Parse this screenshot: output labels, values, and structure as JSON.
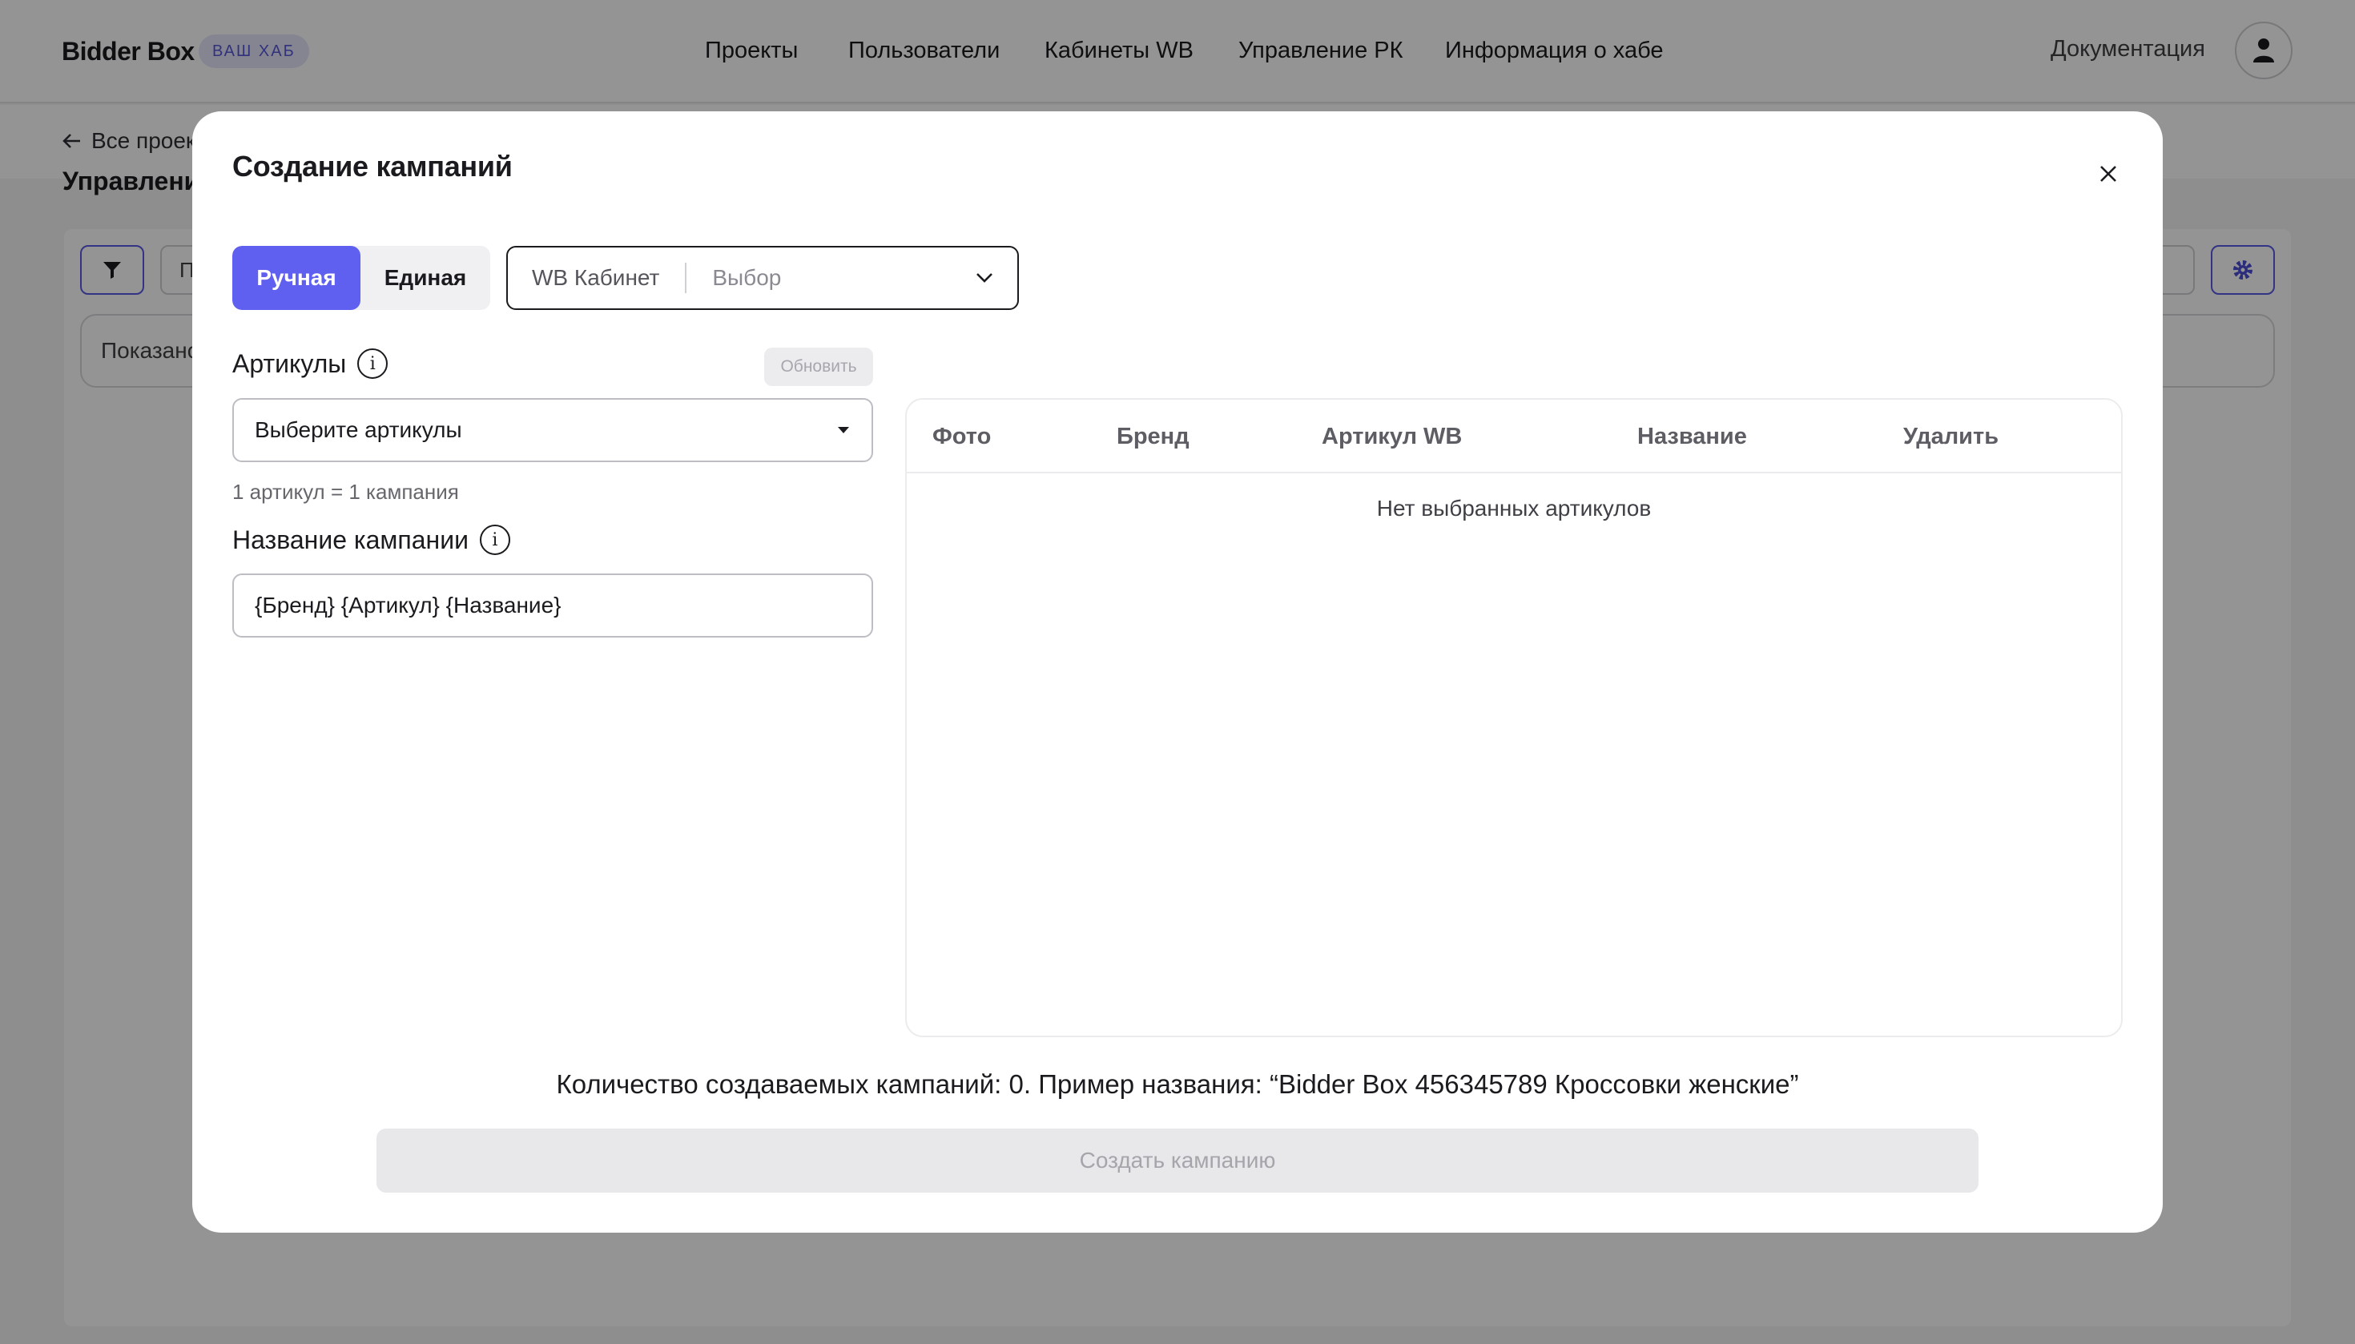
{
  "header": {
    "logo": "Bidder Box",
    "hub_badge": "ВАШ ХАБ",
    "nav": [
      "Проекты",
      "Пользователи",
      "Кабинеты WB",
      "Управление РК",
      "Информация о хабе"
    ],
    "docs": "Документация"
  },
  "background": {
    "back_link": "Все проек",
    "page_title": "Управлени",
    "filter_input_text": "П",
    "shown_text": "Показано"
  },
  "modal": {
    "title": "Создание кампаний",
    "mode_tabs": [
      "Ручная",
      "Единая"
    ],
    "active_mode": "Ручная",
    "cabinet": {
      "label": "WB Кабинет",
      "value": "Выбор"
    },
    "articles_label": "Артикулы",
    "refresh_label": "Обновить",
    "articles_select": "Выберите артикулы",
    "articles_hint": "1 артикул = 1 кампания",
    "campaign_name_label": "Название кампании",
    "campaign_name_value": "{Бренд} {Артикул} {Название}",
    "table": {
      "columns": [
        "Фото",
        "Бренд",
        "Артикул WB",
        "Название",
        "Удалить"
      ],
      "empty_text": "Нет выбранных артикулов"
    },
    "summary": "Количество создаваемых кампаний: 0. Пример названия: “Bidder Box 456345789 Кроссовки женские”",
    "create_button": "Создать кампанию"
  },
  "colors": {
    "accent": "#5f5ff0",
    "overlay": "rgba(0,0,0,0.42)"
  }
}
